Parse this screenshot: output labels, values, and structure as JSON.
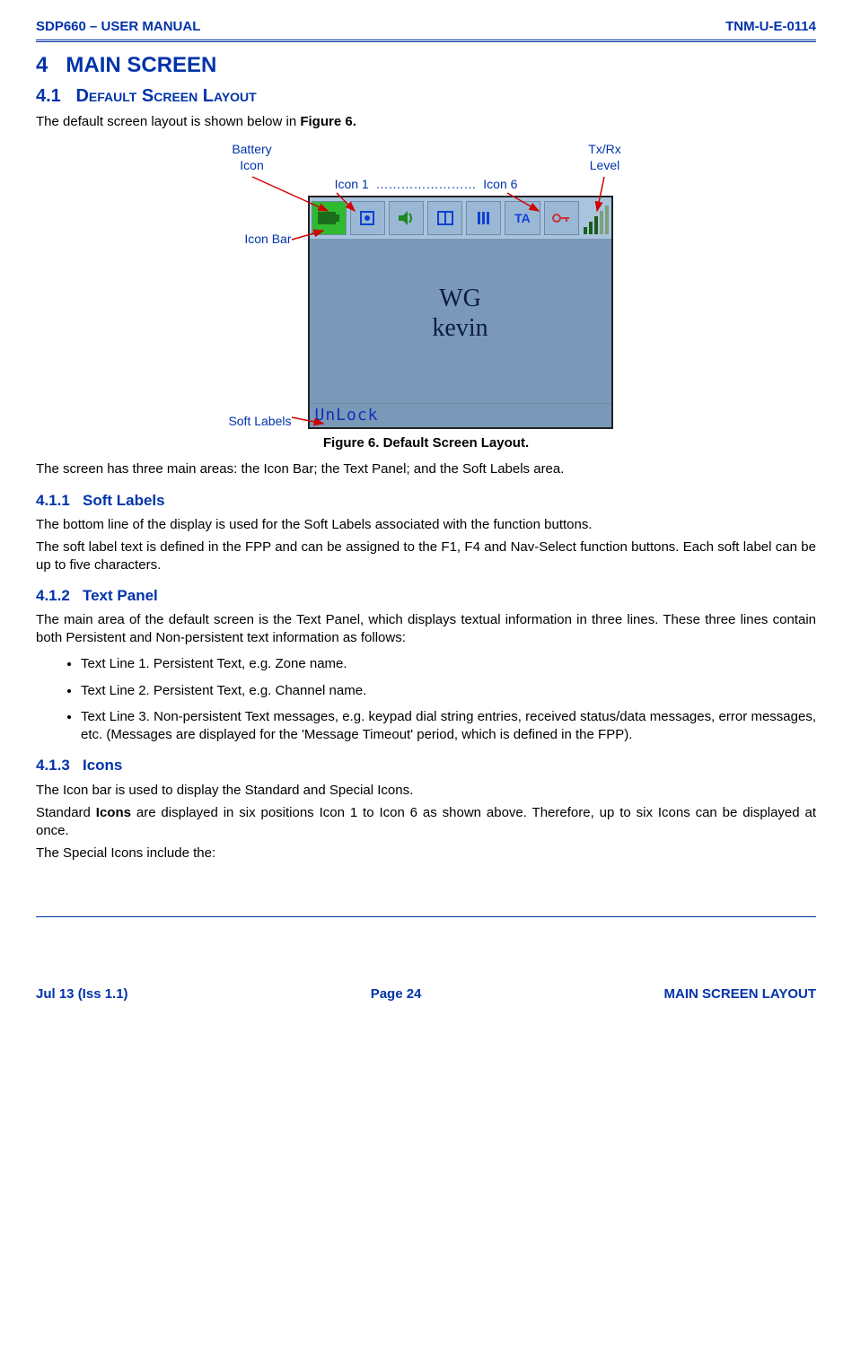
{
  "header": {
    "left": "SDP660 – USER MANUAL",
    "right": "TNM-U-E-0114"
  },
  "sec4": {
    "num": "4",
    "title": "MAIN SCREEN"
  },
  "sec41": {
    "num": "4.1",
    "title": "Default Screen Layout"
  },
  "intro41": "The default screen layout is shown below in ",
  "intro41bold": "Figure 6.",
  "callouts": {
    "battery": "Battery Icon",
    "txrx": "Tx/Rx Level",
    "icon1": "Icon 1",
    "icon6": "Icon 6",
    "dots": "……………………",
    "iconbar": "Icon Bar",
    "soft": "Soft Labels"
  },
  "screen": {
    "line1": "WG",
    "line2": "kevin",
    "softlabel": "UnLock",
    "ta": "TA"
  },
  "caption": "Figure 6.  Default Screen Layout.",
  "aftercap": "The screen has three main areas: the Icon Bar; the Text Panel; and the Soft Labels area.",
  "sec411": {
    "num": "4.1.1",
    "title": "Soft Labels"
  },
  "p411a": "The bottom line of the display is used for the Soft Labels associated with the function buttons.",
  "p411b": "The soft label text is defined in the FPP and can be assigned to the F1, F4 and Nav-Select function buttons.  Each soft label can be up to five characters.",
  "sec412": {
    "num": "4.1.2",
    "title": "Text Panel"
  },
  "p412a": "The main area of the default screen is the Text Panel, which displays textual information in three lines.  These three lines contain both Persistent and Non-persistent text information as follows:",
  "bullets": [
    "Text Line 1.  Persistent Text, e.g. Zone name.",
    "Text Line 2.  Persistent Text, e.g. Channel name.",
    "Text Line 3.  Non-persistent Text messages, e.g. keypad dial string entries, received status/data messages, error messages, etc.  (Messages are displayed for the 'Message Timeout' period, which is defined in the FPP)."
  ],
  "sec413": {
    "num": "4.1.3",
    "title": "Icons"
  },
  "p413a": "The Icon bar is used to display the Standard and Special Icons.",
  "p413b_pre": "Standard ",
  "p413b_bold": "Icons",
  "p413b_post": " are displayed in six positions Icon 1 to Icon 6 as shown above.  Therefore, up to six Icons can be displayed at once.",
  "p413c": "The Special Icons include the:",
  "footer": {
    "left": "Jul 13 (Iss 1.1)",
    "center": "Page 24",
    "right": "MAIN SCREEN LAYOUT"
  }
}
